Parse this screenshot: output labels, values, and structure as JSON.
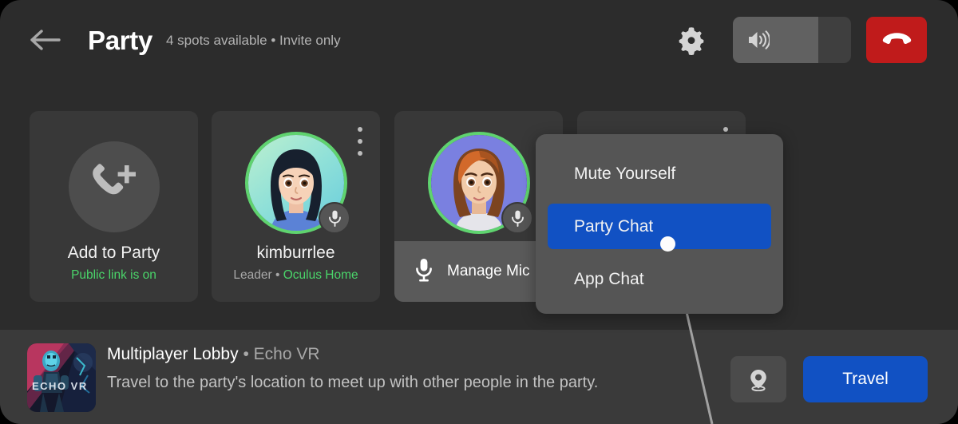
{
  "header": {
    "back_icon": "arrow-left-icon",
    "title": "Party",
    "subtitle": "4 spots available • Invite only",
    "gear_icon": "gear-icon",
    "volume": {
      "icon": "speaker-volume-icon",
      "level_percent": 72
    },
    "hangup_icon": "phone-hangup-icon"
  },
  "cards": [
    {
      "type": "add",
      "icon": "phone-add-icon",
      "name": "Add to Party",
      "sub": "Public link is on",
      "sub_color": "#4ad56a"
    },
    {
      "type": "member",
      "name": "kimburrlee",
      "role": "Leader",
      "separator": "•",
      "location": "Oculus Home",
      "location_color": "#4ad56a",
      "mic_icon": "microphone-icon",
      "kebab_icon": "kebab-menu-icon",
      "ring_color": "#5fd36f"
    },
    {
      "type": "member",
      "overlay_label": "Manage Mic",
      "overlay_icon": "microphone-icon",
      "mic_icon": "microphone-icon",
      "ring_color": "#5fd36f"
    },
    {
      "type": "member",
      "kebab_icon": "kebab-menu-icon"
    }
  ],
  "dropdown": {
    "items": [
      {
        "label": "Mute Yourself",
        "selected": false
      },
      {
        "label": "Party Chat",
        "selected": true
      },
      {
        "label": "App Chat",
        "selected": false
      }
    ],
    "highlight_color": "#1151c3",
    "cursor": "vr-pointer-dot"
  },
  "bottom": {
    "thumb_alt": "echo-vr-cover-art",
    "thumb_text": "ECHO VR",
    "title": "Multiplayer Lobby",
    "separator": "•",
    "app": "Echo VR",
    "description": "Travel to the party's location to meet up with other people in the party.",
    "locate_icon": "location-pin-icon",
    "travel_label": "Travel",
    "travel_color": "#1151c3"
  }
}
